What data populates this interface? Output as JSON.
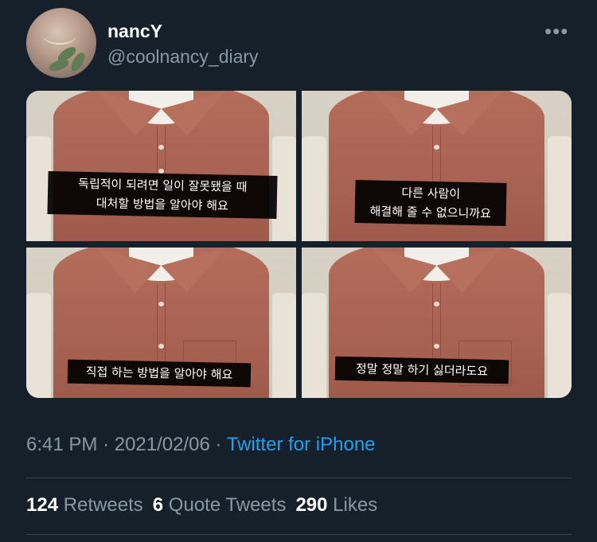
{
  "tweet": {
    "display_name": "nancY",
    "handle": "@coolnancy_diary",
    "more_icon": "more-horizontal-icon",
    "time": "6:41 PM",
    "date": "2021/02/06",
    "source": "Twitter for iPhone"
  },
  "media": {
    "photos": [
      {
        "caption": [
          "독립적이 되려면 일이 잘못됐을 때",
          "대처할 방법을 알아야 해요"
        ]
      },
      {
        "caption": [
          "다른 사람이",
          "해결해 줄 수 없으니까요"
        ]
      },
      {
        "caption": [
          "직접 하는 방법을 알아야 해요"
        ]
      },
      {
        "caption": [
          "정말 정말 하기 싫더라도요"
        ]
      }
    ]
  },
  "stats": {
    "retweets_count": "124",
    "retweets_label": "Retweets",
    "quotes_count": "6",
    "quotes_label": "Quote Tweets",
    "likes_count": "290",
    "likes_label": "Likes"
  },
  "colors": {
    "background": "#15202b",
    "secondary_text": "#8899a6",
    "link": "#1da1f2",
    "divider": "#38444d"
  }
}
